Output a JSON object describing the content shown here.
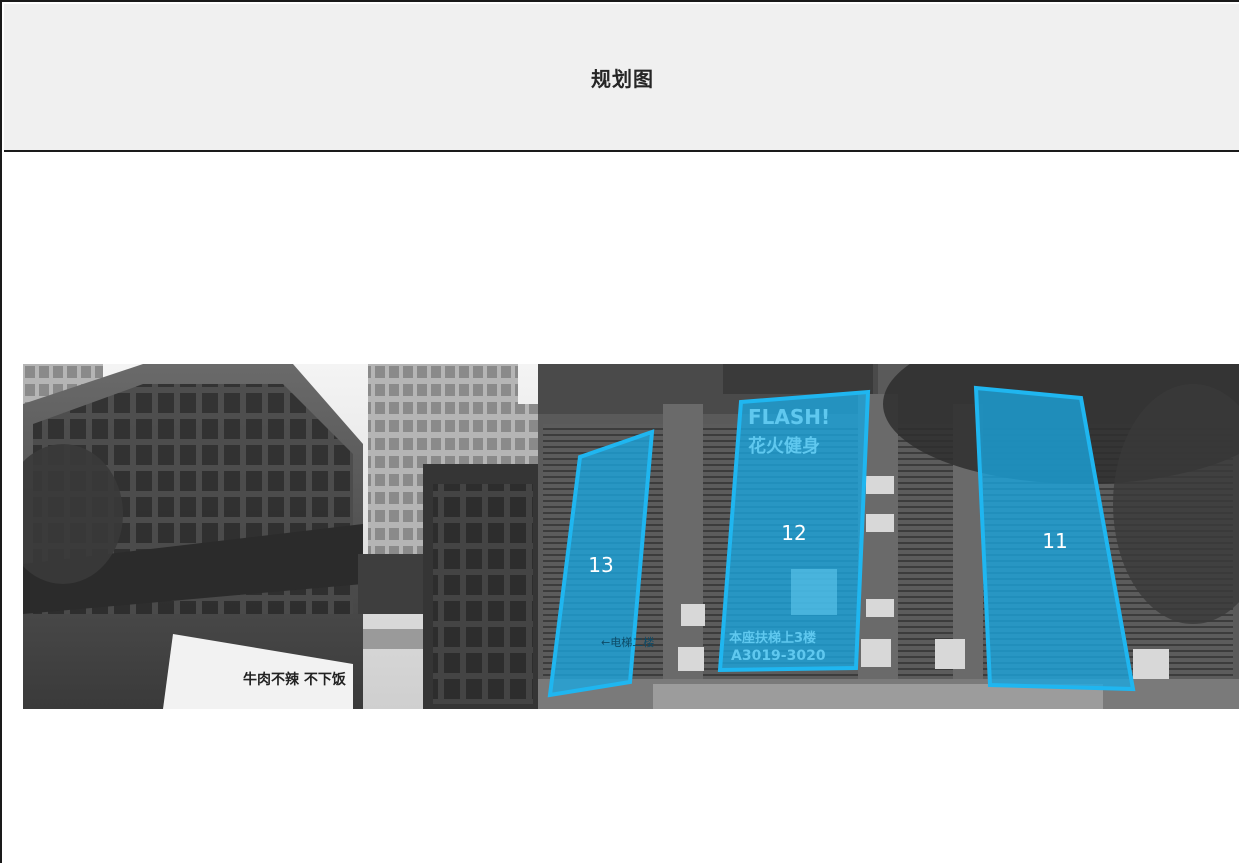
{
  "header": {
    "title": "规划图"
  },
  "photo": {
    "description_type": "grayscale street photo of commercial building facade",
    "zones": [
      {
        "label": "13"
      },
      {
        "label": "12"
      },
      {
        "label": "11"
      }
    ],
    "signs": {
      "zone12_brand": "FLASH!",
      "zone12_name": "花火健身",
      "zone12_address": "本座扶梯上3楼",
      "zone12_room": "A3019-3020",
      "zone13_direction": "←电梯二楼",
      "left_billboard": "牛肉不辣 不下饭"
    }
  },
  "colors": {
    "zone_stroke": "#1fb6f0",
    "zone_fill": "#1aa7e0",
    "header_bg": "#f0f0f0",
    "border": "#1a1a1a"
  }
}
